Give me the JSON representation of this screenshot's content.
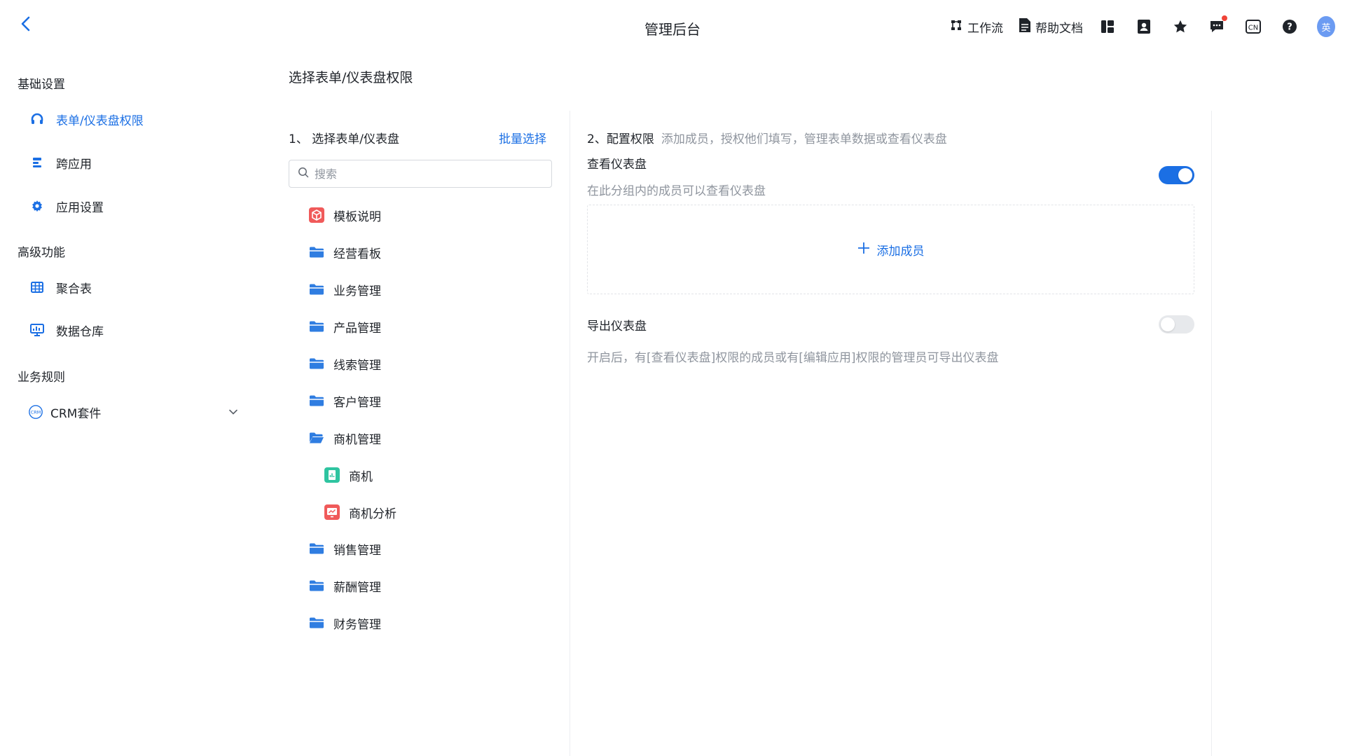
{
  "header": {
    "title": "管理后台",
    "workflow_label": "工作流",
    "help_docs_label": "帮助文档",
    "avatar_text": "英"
  },
  "sidebar": {
    "groups": [
      {
        "label": "基础设置"
      },
      {
        "label": "高级功能"
      },
      {
        "label": "业务规则"
      }
    ],
    "items": [
      {
        "label": "表单/仪表盘权限",
        "icon": "headset-icon",
        "active": true
      },
      {
        "label": "跨应用",
        "icon": "cross-app-icon"
      },
      {
        "label": "应用设置",
        "icon": "gear-icon"
      },
      {
        "label": "聚合表",
        "icon": "grid-table-icon"
      },
      {
        "label": "数据仓库",
        "icon": "monitor-chart-icon"
      },
      {
        "label": "CRM套件",
        "icon": "crm-icon"
      }
    ]
  },
  "main": {
    "section_title": "选择表单/仪表盘权限",
    "left": {
      "heading": "1、 选择表单/仪表盘",
      "batch_select": "批量选择",
      "search_placeholder": "搜索",
      "tree": [
        {
          "label": "模板说明",
          "icon": "cube-icon"
        },
        {
          "label": "经营看板",
          "icon": "folder-icon"
        },
        {
          "label": "业务管理",
          "icon": "folder-icon"
        },
        {
          "label": "产品管理",
          "icon": "folder-icon"
        },
        {
          "label": "线索管理",
          "icon": "folder-icon"
        },
        {
          "label": "客户管理",
          "icon": "folder-icon"
        },
        {
          "label": "商机管理",
          "icon": "folder-open-icon"
        },
        {
          "label": "商机",
          "icon": "form-icon"
        },
        {
          "label": "商机分析",
          "icon": "dashboard-icon"
        },
        {
          "label": "销售管理",
          "icon": "folder-icon"
        },
        {
          "label": "薪酬管理",
          "icon": "folder-icon"
        },
        {
          "label": "财务管理",
          "icon": "folder-icon"
        }
      ]
    },
    "right": {
      "heading": "2、配置权限",
      "hint": "添加成员，授权他们填写，管理表单数据或查看仪表盘",
      "view": {
        "title": "查看仪表盘",
        "desc": "在此分组内的成员可以查看仪表盘",
        "enabled": true
      },
      "add_member": "添加成员",
      "export": {
        "title": "导出仪表盘",
        "desc": "开启后，有[查看仪表盘]权限的成员或有[编辑应用]权限的管理员可导出仪表盘",
        "enabled": false
      }
    }
  },
  "colors": {
    "accent": "#1b6fe4",
    "muted_text": "#8f959e",
    "folder": "#2f7de1",
    "cube_red": "#f05a5a",
    "form_green": "#2ec4a0",
    "notification_red": "#f04438"
  }
}
